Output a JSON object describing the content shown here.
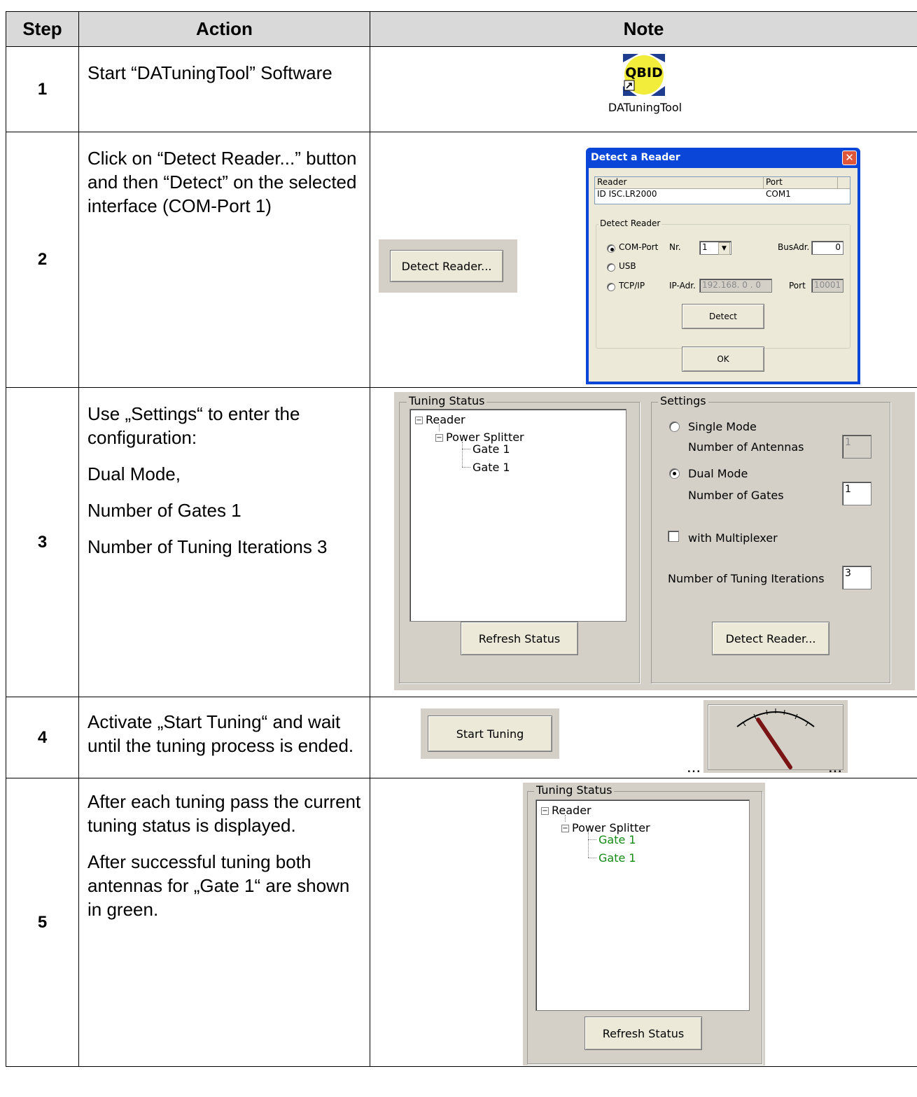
{
  "table": {
    "headers": {
      "step": "Step",
      "action": "Action",
      "note": "Note"
    },
    "rows": [
      {
        "step": "1",
        "action": [
          "Start “DATuningTool” Software"
        ]
      },
      {
        "step": "2",
        "action": [
          "Click on “Detect Reader...” button and then “Detect” on the selected interface (COM-Port 1)"
        ]
      },
      {
        "step": "3",
        "action": [
          "Use „Settings“ to enter the configuration:",
          "Dual Mode,",
          "Number of Gates 1",
          "Number of Tuning Iterations 3"
        ]
      },
      {
        "step": "4",
        "action": [
          "Activate „Start Tuning“ and wait until the tuning process is ended."
        ]
      },
      {
        "step": "5",
        "action": [
          "After each tuning pass the current tuning status is displayed.",
          "After successful tuning both antennas for „Gate 1“ are shown in green."
        ]
      }
    ]
  },
  "step1": {
    "logo_text": "QBID",
    "icon_label": "DATuningTool"
  },
  "step2": {
    "detect_reader_button": "Detect Reader...",
    "dialog": {
      "title": "Detect a Reader",
      "list_headers": {
        "reader": "Reader",
        "port": "Port"
      },
      "list_row": {
        "reader": "ID ISC.LR2000",
        "port": "COM1"
      },
      "group_label": "Detect Reader",
      "options": {
        "com": "COM-Port",
        "usb": "USB",
        "tcp": "TCP/IP"
      },
      "nr_label": "Nr.",
      "nr_value": "1",
      "busadr_label": "BusAdr.",
      "busadr_value": "0",
      "ipadr_label": "IP-Adr.",
      "ipadr_value": "192.168. 0 . 0",
      "port_label": "Port",
      "port_value": "10001",
      "detect_button": "Detect",
      "ok_button": "OK"
    }
  },
  "step3": {
    "tuning_status_label": "Tuning Status",
    "tree": {
      "reader": "Reader",
      "splitter": "Power Splitter",
      "gate_a": "Gate 1",
      "gate_b": "Gate 1"
    },
    "refresh_button": "Refresh Status",
    "settings_label": "Settings",
    "single_mode": "Single Mode",
    "num_antennas_label": "Number of Antennas",
    "num_antennas_value": "1",
    "dual_mode": "Dual Mode",
    "num_gates_label": "Number of Gates",
    "num_gates_value": "1",
    "multiplexer": "with Multiplexer",
    "iterations_label": "Number of Tuning Iterations",
    "iterations_value": "3",
    "detect_button": "Detect Reader..."
  },
  "step4": {
    "start_button": "Start Tuning",
    "ellipsis_left": "...",
    "ellipsis_right": "..."
  },
  "step5": {
    "tuning_status_label": "Tuning Status",
    "tree": {
      "reader": "Reader",
      "splitter": "Power Splitter",
      "gate_a": "Gate 1",
      "gate_b": "Gate 1"
    },
    "gate_color": "#138a13",
    "refresh_button": "Refresh Status"
  }
}
